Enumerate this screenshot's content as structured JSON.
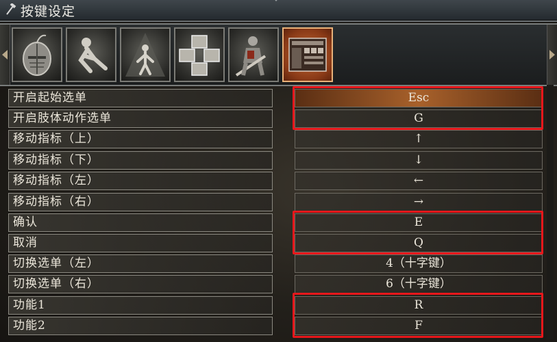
{
  "window": {
    "title": "按键设定"
  },
  "tabs": [
    {
      "name": "tab-helmet",
      "icon": "helmet-icon",
      "active": false
    },
    {
      "name": "tab-gesture",
      "icon": "gesture-icon",
      "active": false
    },
    {
      "name": "tab-character",
      "icon": "character-icon",
      "active": false
    },
    {
      "name": "tab-equipment",
      "icon": "equipment-slots-icon",
      "active": false
    },
    {
      "name": "tab-knight",
      "icon": "knight-icon",
      "active": false
    },
    {
      "name": "tab-key-config",
      "icon": "key-config-icon",
      "active": true
    }
  ],
  "bindings": [
    {
      "action": "开启起始选单",
      "key": "Esc"
    },
    {
      "action": "开启肢体动作选单",
      "key": "G"
    },
    {
      "action": "移动指标（上）",
      "key": "↑"
    },
    {
      "action": "移动指标（下）",
      "key": "↓"
    },
    {
      "action": "移动指标（左）",
      "key": "←"
    },
    {
      "action": "移动指标（右）",
      "key": "→"
    },
    {
      "action": "确认",
      "key": "E"
    },
    {
      "action": "取消",
      "key": "Q"
    },
    {
      "action": "切换选单（左）",
      "key": "4（十字键）"
    },
    {
      "action": "切换选单（右）",
      "key": "6（十字键）"
    },
    {
      "action": "功能1",
      "key": "R"
    },
    {
      "action": "功能2",
      "key": "F"
    }
  ],
  "selected_row": 0,
  "highlight_color": "#e8171b",
  "accent_color": "#c56a35"
}
